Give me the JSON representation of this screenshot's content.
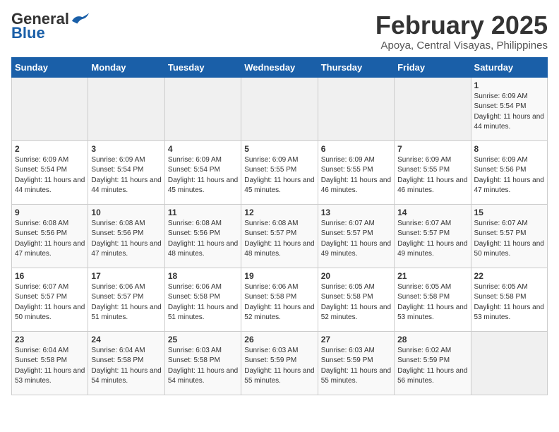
{
  "logo": {
    "general": "General",
    "blue": "Blue"
  },
  "title": "February 2025",
  "location": "Apoya, Central Visayas, Philippines",
  "days_of_week": [
    "Sunday",
    "Monday",
    "Tuesday",
    "Wednesday",
    "Thursday",
    "Friday",
    "Saturday"
  ],
  "weeks": [
    [
      {
        "day": "",
        "info": ""
      },
      {
        "day": "",
        "info": ""
      },
      {
        "day": "",
        "info": ""
      },
      {
        "day": "",
        "info": ""
      },
      {
        "day": "",
        "info": ""
      },
      {
        "day": "",
        "info": ""
      },
      {
        "day": "1",
        "sunrise": "6:09 AM",
        "sunset": "5:54 PM",
        "daylight": "11 hours and 44 minutes."
      }
    ],
    [
      {
        "day": "2",
        "sunrise": "6:09 AM",
        "sunset": "5:54 PM",
        "daylight": "11 hours and 44 minutes."
      },
      {
        "day": "3",
        "sunrise": "6:09 AM",
        "sunset": "5:54 PM",
        "daylight": "11 hours and 44 minutes."
      },
      {
        "day": "4",
        "sunrise": "6:09 AM",
        "sunset": "5:54 PM",
        "daylight": "11 hours and 45 minutes."
      },
      {
        "day": "5",
        "sunrise": "6:09 AM",
        "sunset": "5:55 PM",
        "daylight": "11 hours and 45 minutes."
      },
      {
        "day": "6",
        "sunrise": "6:09 AM",
        "sunset": "5:55 PM",
        "daylight": "11 hours and 46 minutes."
      },
      {
        "day": "7",
        "sunrise": "6:09 AM",
        "sunset": "5:55 PM",
        "daylight": "11 hours and 46 minutes."
      },
      {
        "day": "8",
        "sunrise": "6:09 AM",
        "sunset": "5:56 PM",
        "daylight": "11 hours and 47 minutes."
      }
    ],
    [
      {
        "day": "9",
        "sunrise": "6:08 AM",
        "sunset": "5:56 PM",
        "daylight": "11 hours and 47 minutes."
      },
      {
        "day": "10",
        "sunrise": "6:08 AM",
        "sunset": "5:56 PM",
        "daylight": "11 hours and 47 minutes."
      },
      {
        "day": "11",
        "sunrise": "6:08 AM",
        "sunset": "5:56 PM",
        "daylight": "11 hours and 48 minutes."
      },
      {
        "day": "12",
        "sunrise": "6:08 AM",
        "sunset": "5:57 PM",
        "daylight": "11 hours and 48 minutes."
      },
      {
        "day": "13",
        "sunrise": "6:07 AM",
        "sunset": "5:57 PM",
        "daylight": "11 hours and 49 minutes."
      },
      {
        "day": "14",
        "sunrise": "6:07 AM",
        "sunset": "5:57 PM",
        "daylight": "11 hours and 49 minutes."
      },
      {
        "day": "15",
        "sunrise": "6:07 AM",
        "sunset": "5:57 PM",
        "daylight": "11 hours and 50 minutes."
      }
    ],
    [
      {
        "day": "16",
        "sunrise": "6:07 AM",
        "sunset": "5:57 PM",
        "daylight": "11 hours and 50 minutes."
      },
      {
        "day": "17",
        "sunrise": "6:06 AM",
        "sunset": "5:57 PM",
        "daylight": "11 hours and 51 minutes."
      },
      {
        "day": "18",
        "sunrise": "6:06 AM",
        "sunset": "5:58 PM",
        "daylight": "11 hours and 51 minutes."
      },
      {
        "day": "19",
        "sunrise": "6:06 AM",
        "sunset": "5:58 PM",
        "daylight": "11 hours and 52 minutes."
      },
      {
        "day": "20",
        "sunrise": "6:05 AM",
        "sunset": "5:58 PM",
        "daylight": "11 hours and 52 minutes."
      },
      {
        "day": "21",
        "sunrise": "6:05 AM",
        "sunset": "5:58 PM",
        "daylight": "11 hours and 53 minutes."
      },
      {
        "day": "22",
        "sunrise": "6:05 AM",
        "sunset": "5:58 PM",
        "daylight": "11 hours and 53 minutes."
      }
    ],
    [
      {
        "day": "23",
        "sunrise": "6:04 AM",
        "sunset": "5:58 PM",
        "daylight": "11 hours and 53 minutes."
      },
      {
        "day": "24",
        "sunrise": "6:04 AM",
        "sunset": "5:58 PM",
        "daylight": "11 hours and 54 minutes."
      },
      {
        "day": "25",
        "sunrise": "6:03 AM",
        "sunset": "5:58 PM",
        "daylight": "11 hours and 54 minutes."
      },
      {
        "day": "26",
        "sunrise": "6:03 AM",
        "sunset": "5:59 PM",
        "daylight": "11 hours and 55 minutes."
      },
      {
        "day": "27",
        "sunrise": "6:03 AM",
        "sunset": "5:59 PM",
        "daylight": "11 hours and 55 minutes."
      },
      {
        "day": "28",
        "sunrise": "6:02 AM",
        "sunset": "5:59 PM",
        "daylight": "11 hours and 56 minutes."
      },
      {
        "day": "",
        "info": ""
      }
    ]
  ],
  "labels": {
    "sunrise": "Sunrise: ",
    "sunset": "Sunset: ",
    "daylight": "Daylight: "
  }
}
